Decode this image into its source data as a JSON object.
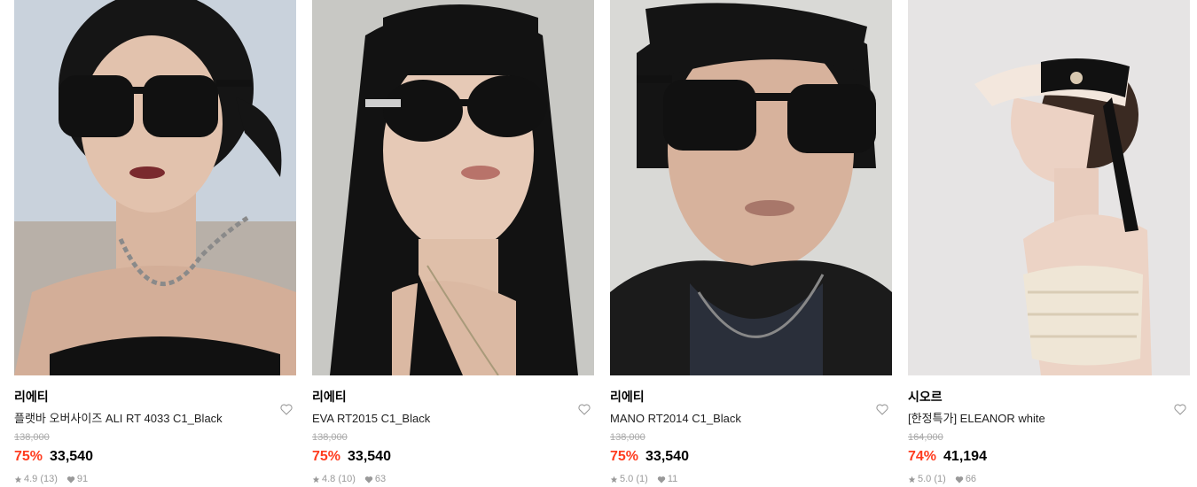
{
  "products": [
    {
      "brand": "리에티",
      "name": "플랫바 오버사이즈 ALI RT 4033 C1_Black",
      "original_price": "138,000",
      "discount": "75%",
      "price": "33,540",
      "rating": "4.9",
      "review_count": "(13)",
      "likes": "91",
      "bg_color": "#c9d2dc"
    },
    {
      "brand": "리에티",
      "name": "EVA RT2015 C1_Black",
      "original_price": "138,000",
      "discount": "75%",
      "price": "33,540",
      "rating": "4.8",
      "review_count": "(10)",
      "likes": "63",
      "bg_color": "#c8c8c4"
    },
    {
      "brand": "리에티",
      "name": "MANO RT2014 C1_Black",
      "original_price": "138,000",
      "discount": "75%",
      "price": "33,540",
      "rating": "5.0",
      "review_count": "(1)",
      "likes": "11",
      "bg_color": "#d9d9d6"
    },
    {
      "brand": "시오르",
      "name": "[한정특가] ELEANOR white",
      "original_price": "164,000",
      "discount": "74%",
      "price": "41,194",
      "rating": "5.0",
      "review_count": "(1)",
      "likes": "66",
      "bg_color": "#e6e4e4"
    }
  ],
  "colors": {
    "discount": "#ff3c1f",
    "meta": "#999999"
  }
}
